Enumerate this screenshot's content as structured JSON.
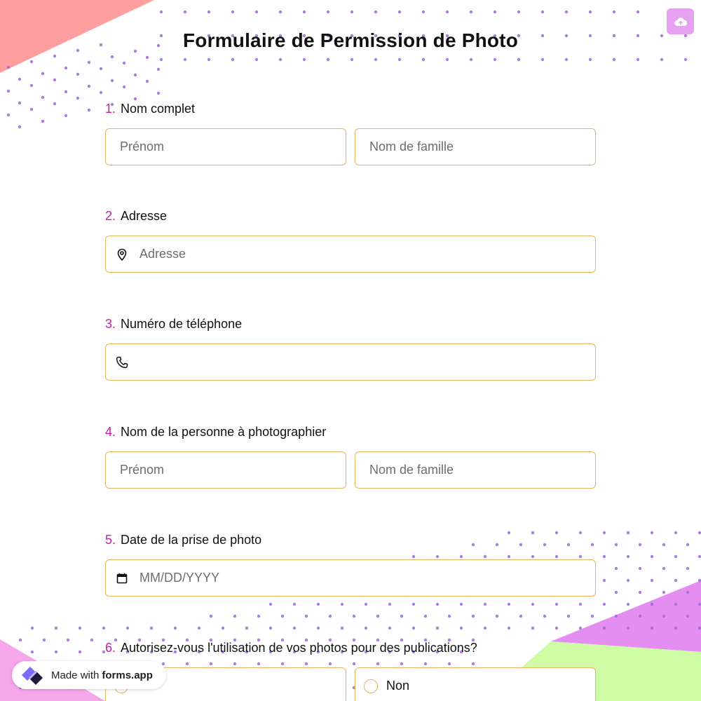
{
  "form": {
    "title": "Formulaire de Permission de Photo"
  },
  "colors": {
    "accent_number": "#c21fa6",
    "field_border": "#e8b35e",
    "dots": "#9b6ad8",
    "corner_top_left": "#ff9e9e",
    "corner_bottom_right_pink": "#e58ef2",
    "corner_bottom_right_green": "#cdfca5",
    "upload_button": "#e6a1f0"
  },
  "header": {
    "upload_icon": "cloud-upload-icon"
  },
  "questions": [
    {
      "number": "1.",
      "label": "Nom complet",
      "first_placeholder": "Prénom",
      "last_placeholder": "Nom de famille"
    },
    {
      "number": "2.",
      "label": "Adresse",
      "icon": "map-pin-icon",
      "placeholder": "Adresse"
    },
    {
      "number": "3.",
      "label": "Numéro de téléphone",
      "icon": "phone-icon",
      "placeholder": ""
    },
    {
      "number": "4.",
      "label": "Nom de la personne à photographier",
      "first_placeholder": "Prénom",
      "last_placeholder": "Nom de famille"
    },
    {
      "number": "5.",
      "label": "Date de la prise de photo",
      "icon": "calendar-icon",
      "placeholder": "MM/DD/YYYY"
    },
    {
      "number": "6.",
      "label": "Autorisez-vous l'utilisation de vos photos pour des publications?",
      "options": [
        "",
        "Non"
      ]
    }
  ],
  "badge": {
    "prefix": "Made with",
    "brand": "forms.app"
  }
}
